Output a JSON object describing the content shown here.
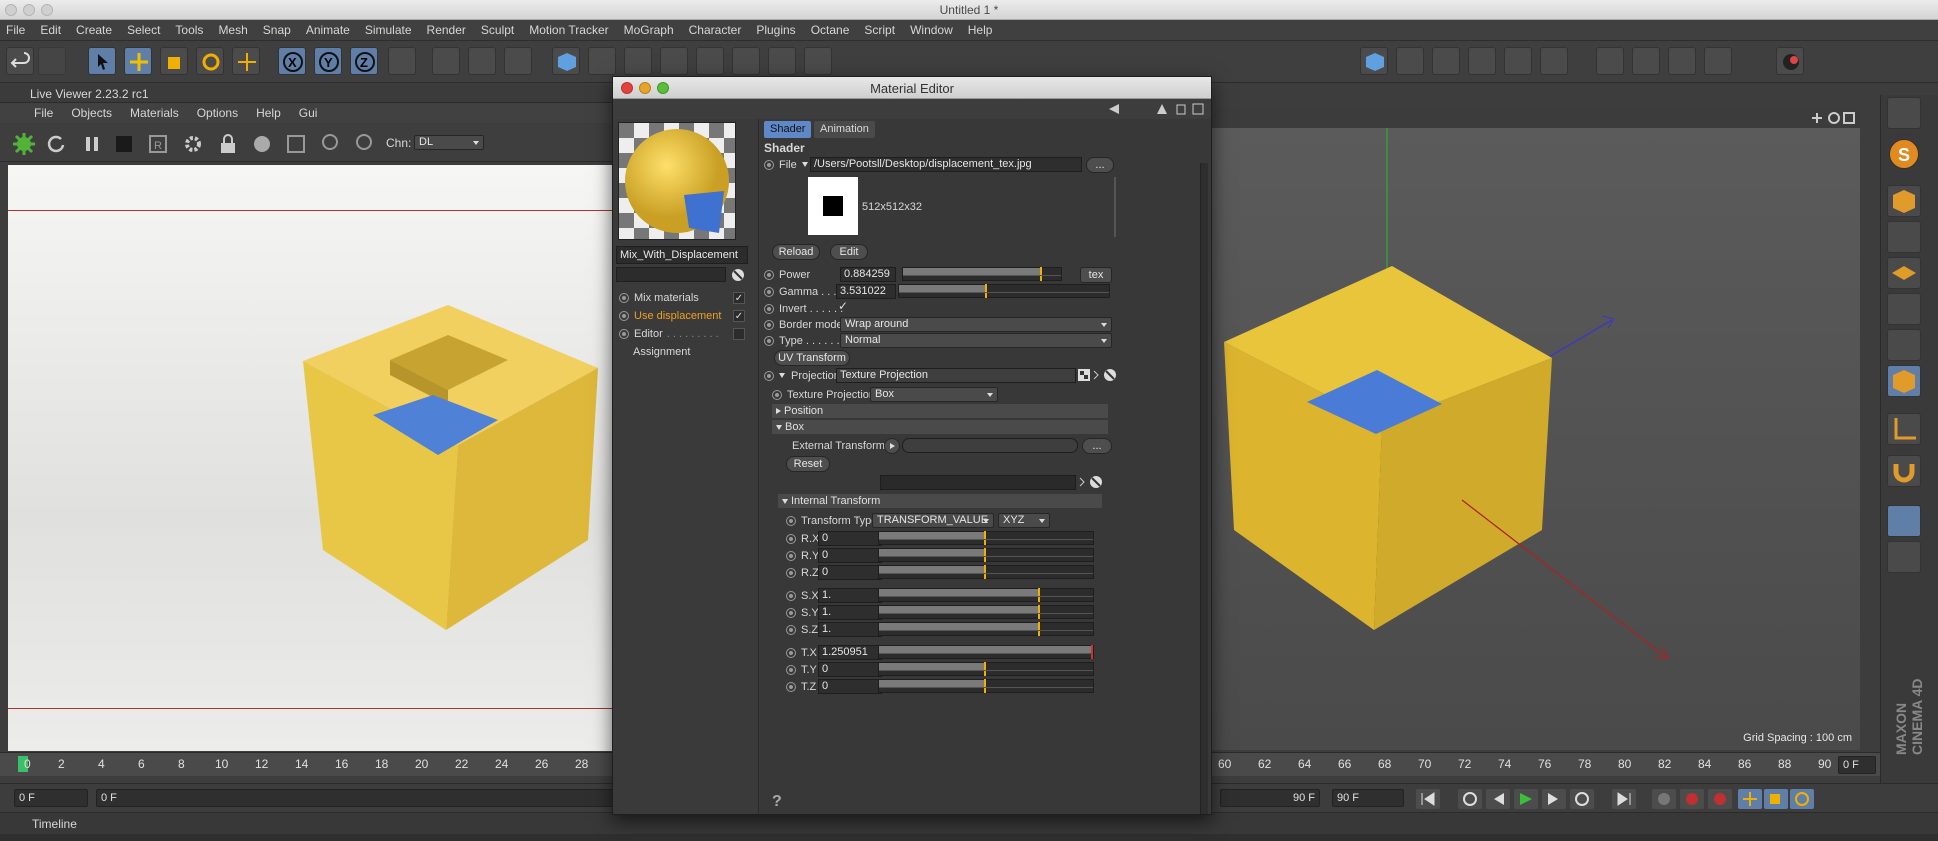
{
  "app": {
    "window_title": "Untitled 1 *",
    "brand": "MAXON CINEMA 4D"
  },
  "menu": [
    "File",
    "Edit",
    "Create",
    "Select",
    "Tools",
    "Mesh",
    "Snap",
    "Animate",
    "Simulate",
    "Render",
    "Sculpt",
    "Motion Tracker",
    "MoGraph",
    "Character",
    "Plugins",
    "Octane",
    "Script",
    "Window",
    "Help"
  ],
  "live_viewer": {
    "title": "Live Viewer 2.23.2 rc1",
    "menu": [
      "File",
      "Objects",
      "Materials",
      "Options",
      "Help",
      "Gui"
    ],
    "chn_label": "Chn:",
    "chn_value": "DL"
  },
  "viewport": {
    "grid_spacing": "Grid Spacing : 100 cm"
  },
  "timeline": {
    "ticks": [
      "0",
      "2",
      "4",
      "6",
      "8",
      "10",
      "12",
      "14",
      "16",
      "18",
      "20",
      "22",
      "24",
      "26",
      "28",
      "60",
      "62",
      "64",
      "66",
      "68",
      "70",
      "72",
      "74",
      "76",
      "78",
      "80",
      "82",
      "84",
      "86",
      "88",
      "90"
    ],
    "current_frame": "0 F",
    "current_frame_right": "0 F",
    "start": "0 F",
    "slider_start": "0 F",
    "end_a": "90 F",
    "end_b": "90 F",
    "panel_label": "Timeline"
  },
  "material_editor": {
    "title": "Material Editor",
    "material_name": "Mix_With_Displacement",
    "channels": [
      {
        "label": "Mix materials",
        "checked": true,
        "active": false
      },
      {
        "label": "Use displacement",
        "checked": true,
        "active": true
      },
      {
        "label": "Editor",
        "checked": false,
        "active": false
      },
      {
        "label": "Assignment",
        "checked": false,
        "active": false
      }
    ],
    "tabs": [
      "Shader",
      "Animation"
    ],
    "section": "Shader",
    "file": {
      "label": "File",
      "path": "/Users/Pootsll/Desktop/displacement_tex.jpg",
      "browse": "...",
      "info": "512x512x32"
    },
    "reload": "Reload",
    "edit": "Edit",
    "power": {
      "label": "Power",
      "value": "0.884259",
      "fraction": 0.88,
      "btn": "tex"
    },
    "gamma": {
      "label": "Gamma . . . .",
      "value": "3.531022",
      "fraction": 0.42
    },
    "invert": {
      "label": "Invert . . . . . .",
      "checked": true
    },
    "border_mode": {
      "label": "Border mode",
      "value": "Wrap around"
    },
    "type": {
      "label": "Type . . . . . . .",
      "value": "Normal"
    },
    "uv_transform": "UV Transform",
    "projection": {
      "label": "Projection",
      "value": "Texture Projection"
    },
    "texture_projection": {
      "label": "Texture Projection",
      "value": "Box"
    },
    "position": "Position",
    "box": "Box",
    "external_transform": {
      "label": "External Transform",
      "browse": "..."
    },
    "reset": "Reset",
    "internal_transform": "Internal Transform",
    "transform_type": {
      "label": "Transform Type",
      "value": "TRANSFORM_VALUE",
      "order": "XYZ"
    },
    "transforms": [
      {
        "label": "R.X",
        "value": "0",
        "fraction": 0.5
      },
      {
        "label": "R.Y",
        "value": "0",
        "fraction": 0.5
      },
      {
        "label": "R.Z",
        "value": "0",
        "fraction": 0.5
      },
      {
        "label": "S.X",
        "value": "1.",
        "fraction": 0.75
      },
      {
        "label": "S.Y",
        "value": "1.",
        "fraction": 0.75
      },
      {
        "label": "S.Z",
        "value": "1.",
        "fraction": 0.75
      },
      {
        "label": "T.X",
        "value": "1.250951",
        "fraction": 1.0
      },
      {
        "label": "T.Y",
        "value": "0",
        "fraction": 0.5
      },
      {
        "label": "T.Z",
        "value": "0",
        "fraction": 0.5
      }
    ],
    "help": "?"
  },
  "colors": {
    "accent_blue": "#5f88c9",
    "active_orange": "#f0a020",
    "cube_yellow": "#e9c53b",
    "panel": "#3a3a3a"
  }
}
